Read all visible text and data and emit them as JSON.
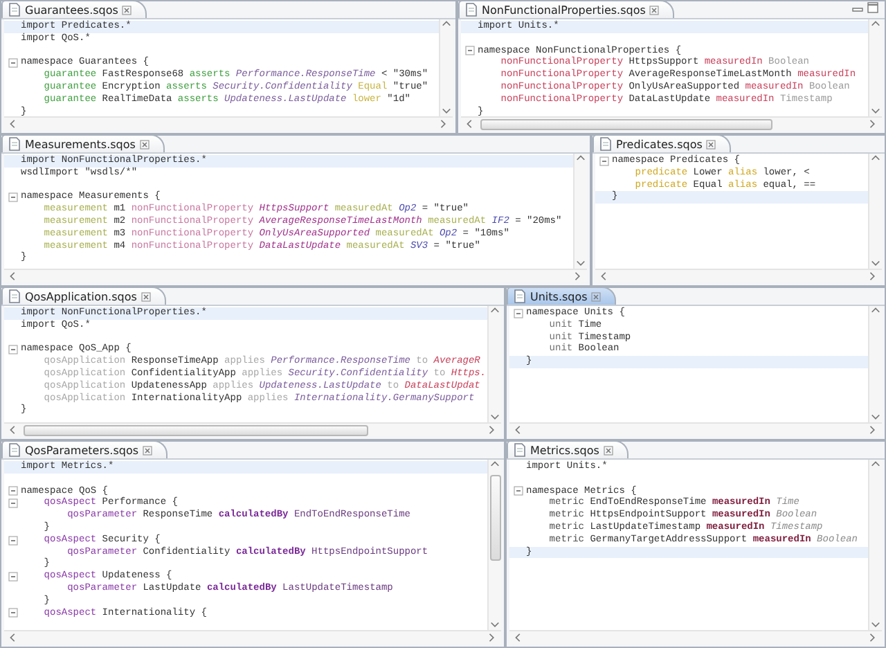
{
  "rows": [
    {
      "panes": [
        {
          "tab": {
            "label": "Guarantees.sqos",
            "selected": false
          },
          "view_buttons": false,
          "lines": [
            {
              "fold": false,
              "highlighted": true,
              "tokens": [
                {
                  "text": "import Predicates.*",
                  "color": "#333333",
                  "kind": "normal"
                }
              ]
            },
            {
              "fold": false,
              "highlighted": false,
              "tokens": [
                {
                  "text": "import QoS.*",
                  "color": "#333333",
                  "kind": "normal"
                }
              ]
            },
            {
              "fold": false,
              "highlighted": false
            },
            {
              "fold": true,
              "highlighted": false,
              "tokens": [
                {
                  "text": "namespace Guarantees {",
                  "color": "#333333",
                  "kind": "normal"
                }
              ]
            },
            {
              "fold": false,
              "highlighted": false,
              "tokens": [
                {
                  "text": "    guarantee",
                  "color": "#3f9f3f",
                  "kind": "normal"
                },
                {
                  "text": " FastResponse68 ",
                  "color": "#333333",
                  "kind": "normal"
                },
                {
                  "text": "asserts",
                  "color": "#3f9f3f",
                  "kind": "normal"
                },
                {
                  "text": " Performance.ResponseTime",
                  "color": "#7a5c9c",
                  "kind": "italic"
                },
                {
                  "text": " < \"30ms\"",
                  "color": "#333333",
                  "kind": "normal"
                }
              ]
            },
            {
              "fold": false,
              "highlighted": false,
              "tokens": [
                {
                  "text": "    guarantee",
                  "color": "#3f9f3f",
                  "kind": "normal"
                },
                {
                  "text": " Encryption ",
                  "color": "#333333",
                  "kind": "normal"
                },
                {
                  "text": "asserts",
                  "color": "#3f9f3f",
                  "kind": "normal"
                },
                {
                  "text": " Security.Confidentiality ",
                  "color": "#7a5c9c",
                  "kind": "italic"
                },
                {
                  "text": "Equal",
                  "color": "#c8b440",
                  "kind": "normal"
                },
                {
                  "text": " \"true\"",
                  "color": "#333333",
                  "kind": "normal"
                }
              ]
            },
            {
              "fold": false,
              "highlighted": false,
              "tokens": [
                {
                  "text": "    guarantee",
                  "color": "#3f9f3f",
                  "kind": "normal"
                },
                {
                  "text": " RealTimeData ",
                  "color": "#333333",
                  "kind": "normal"
                },
                {
                  "text": "asserts",
                  "color": "#3f9f3f",
                  "kind": "normal"
                },
                {
                  "text": " Updateness.LastUpdate ",
                  "color": "#7a5c9c",
                  "kind": "italic"
                },
                {
                  "text": "lower",
                  "color": "#c8b440",
                  "kind": "normal"
                },
                {
                  "text": " \"1d\"",
                  "color": "#333333",
                  "kind": "normal"
                }
              ]
            },
            {
              "fold": false,
              "highlighted": false,
              "tokens": [
                {
                  "text": "}",
                  "color": "#333333",
                  "kind": "normal"
                }
              ]
            }
          ]
        },
        {
          "tab": {
            "label": "NonFunctionalProperties.sqos",
            "selected": false
          },
          "view_buttons": true,
          "lines": [
            {
              "fold": false,
              "highlighted": true,
              "tokens": [
                {
                  "text": "import Units.*",
                  "color": "#333333",
                  "kind": "normal"
                }
              ]
            },
            {
              "fold": false,
              "highlighted": false
            },
            {
              "fold": true,
              "highlighted": false,
              "tokens": [
                {
                  "text": "namespace NonFunctionalProperties {",
                  "color": "#333333",
                  "kind": "normal"
                }
              ]
            },
            {
              "fold": false,
              "highlighted": false,
              "tokens": [
                {
                  "text": "    nonFunctionalProperty",
                  "color": "#c8405a",
                  "kind": "normal"
                },
                {
                  "text": " HttpsSupport ",
                  "color": "#333333",
                  "kind": "normal"
                },
                {
                  "text": "measuredIn",
                  "color": "#c8405a",
                  "kind": "normal"
                },
                {
                  "text": " Boolean",
                  "color": "#9a9a9a",
                  "kind": "normal"
                }
              ]
            },
            {
              "fold": false,
              "highlighted": false,
              "tokens": [
                {
                  "text": "    nonFunctionalProperty",
                  "color": "#c8405a",
                  "kind": "normal"
                },
                {
                  "text": " AverageResponseTimeLastMonth ",
                  "color": "#333333",
                  "kind": "normal"
                },
                {
                  "text": "measuredIn",
                  "color": "#c8405a",
                  "kind": "normal"
                }
              ]
            },
            {
              "fold": false,
              "highlighted": false,
              "tokens": [
                {
                  "text": "    nonFunctionalProperty",
                  "color": "#c8405a",
                  "kind": "normal"
                },
                {
                  "text": " OnlyUsAreaSupported ",
                  "color": "#333333",
                  "kind": "normal"
                },
                {
                  "text": "measuredIn",
                  "color": "#c8405a",
                  "kind": "normal"
                },
                {
                  "text": " Boolean",
                  "color": "#9a9a9a",
                  "kind": "normal"
                }
              ]
            },
            {
              "fold": false,
              "highlighted": false,
              "tokens": [
                {
                  "text": "    nonFunctionalProperty",
                  "color": "#c8405a",
                  "kind": "normal"
                },
                {
                  "text": " DataLastUpdate ",
                  "color": "#333333",
                  "kind": "normal"
                },
                {
                  "text": "measuredIn",
                  "color": "#c8405a",
                  "kind": "normal"
                },
                {
                  "text": " Timestamp",
                  "color": "#9a9a9a",
                  "kind": "normal"
                }
              ]
            },
            {
              "fold": false,
              "highlighted": false,
              "tokens": [
                {
                  "text": "}",
                  "color": "#333333",
                  "kind": "normal"
                }
              ]
            }
          ]
        }
      ]
    },
    {
      "panes": [
        {
          "tab": {
            "label": "Measurements.sqos",
            "selected": false
          },
          "view_buttons": false,
          "lines": [
            {
              "fold": false,
              "highlighted": true,
              "tokens": [
                {
                  "text": "import NonFunctionalProperties.*",
                  "color": "#333333",
                  "kind": "normal"
                }
              ]
            },
            {
              "fold": false,
              "highlighted": false,
              "tokens": [
                {
                  "text": "wsdlImport \"wsdls/*\"",
                  "color": "#333333",
                  "kind": "normal"
                }
              ]
            },
            {
              "fold": false,
              "highlighted": false
            },
            {
              "fold": true,
              "highlighted": false,
              "tokens": [
                {
                  "text": "namespace Measurements {",
                  "color": "#333333",
                  "kind": "normal"
                }
              ]
            },
            {
              "fold": false,
              "highlighted": false,
              "tokens": [
                {
                  "text": "    measurement",
                  "color": "#a8b050",
                  "kind": "normal"
                },
                {
                  "text": " m1 ",
                  "color": "#333333",
                  "kind": "normal"
                },
                {
                  "text": "nonFunctionalProperty",
                  "color": "#c878a0",
                  "kind": "normal"
                },
                {
                  "text": " HttpsSupport ",
                  "color": "#a0308a",
                  "kind": "italic"
                },
                {
                  "text": "measuredAt",
                  "color": "#a8b050",
                  "kind": "normal"
                },
                {
                  "text": " Op2",
                  "color": "#4a4ab0",
                  "kind": "italic"
                },
                {
                  "text": " = \"true\"",
                  "color": "#333333",
                  "kind": "normal"
                }
              ]
            },
            {
              "fold": false,
              "highlighted": false,
              "tokens": [
                {
                  "text": "    measurement",
                  "color": "#a8b050",
                  "kind": "normal"
                },
                {
                  "text": " m2 ",
                  "color": "#333333",
                  "kind": "normal"
                },
                {
                  "text": "nonFunctionalProperty",
                  "color": "#c878a0",
                  "kind": "normal"
                },
                {
                  "text": " AverageResponseTimeLastMonth ",
                  "color": "#a0308a",
                  "kind": "italic"
                },
                {
                  "text": "measuredAt",
                  "color": "#a8b050",
                  "kind": "normal"
                },
                {
                  "text": " IF2",
                  "color": "#4a4ab0",
                  "kind": "italic"
                },
                {
                  "text": " = \"20ms\"",
                  "color": "#333333",
                  "kind": "normal"
                }
              ]
            },
            {
              "fold": false,
              "highlighted": false,
              "tokens": [
                {
                  "text": "    measurement",
                  "color": "#a8b050",
                  "kind": "normal"
                },
                {
                  "text": " m3 ",
                  "color": "#333333",
                  "kind": "normal"
                },
                {
                  "text": "nonFunctionalProperty",
                  "color": "#c878a0",
                  "kind": "normal"
                },
                {
                  "text": " OnlyUsAreaSupported ",
                  "color": "#a0308a",
                  "kind": "italic"
                },
                {
                  "text": "measuredAt",
                  "color": "#a8b050",
                  "kind": "normal"
                },
                {
                  "text": " Op2",
                  "color": "#4a4ab0",
                  "kind": "italic"
                },
                {
                  "text": " = \"10ms\"",
                  "color": "#333333",
                  "kind": "normal"
                }
              ]
            },
            {
              "fold": false,
              "highlighted": false,
              "tokens": [
                {
                  "text": "    measurement",
                  "color": "#a8b050",
                  "kind": "normal"
                },
                {
                  "text": " m4 ",
                  "color": "#333333",
                  "kind": "normal"
                },
                {
                  "text": "nonFunctionalProperty",
                  "color": "#c878a0",
                  "kind": "normal"
                },
                {
                  "text": " DataLastUpdate ",
                  "color": "#a0308a",
                  "kind": "italic"
                },
                {
                  "text": "measuredAt",
                  "color": "#a8b050",
                  "kind": "normal"
                },
                {
                  "text": " SV3",
                  "color": "#4a4ab0",
                  "kind": "italic"
                },
                {
                  "text": " = \"true\"",
                  "color": "#333333",
                  "kind": "normal"
                }
              ]
            },
            {
              "fold": false,
              "highlighted": false,
              "tokens": [
                {
                  "text": "}",
                  "color": "#333333",
                  "kind": "normal"
                }
              ]
            }
          ]
        },
        {
          "tab": {
            "label": "Predicates.sqos",
            "selected": false
          },
          "view_buttons": false,
          "lines": [
            {
              "fold": true,
              "highlighted": false,
              "tokens": [
                {
                  "text": "namespace Predicates {",
                  "color": "#333333",
                  "kind": "normal"
                }
              ]
            },
            {
              "fold": false,
              "highlighted": false,
              "tokens": [
                {
                  "text": "    predicate",
                  "color": "#d0a820",
                  "kind": "normal"
                },
                {
                  "text": " Lower ",
                  "color": "#333333",
                  "kind": "normal"
                },
                {
                  "text": "alias",
                  "color": "#d0a820",
                  "kind": "normal"
                },
                {
                  "text": " lower, <",
                  "color": "#333333",
                  "kind": "normal"
                }
              ]
            },
            {
              "fold": false,
              "highlighted": false,
              "tokens": [
                {
                  "text": "    predicate",
                  "color": "#d0a820",
                  "kind": "normal"
                },
                {
                  "text": " Equal ",
                  "color": "#333333",
                  "kind": "normal"
                },
                {
                  "text": "alias",
                  "color": "#d0a820",
                  "kind": "normal"
                },
                {
                  "text": " equal, ==",
                  "color": "#333333",
                  "kind": "normal"
                }
              ]
            },
            {
              "fold": false,
              "highlighted": true,
              "tokens": [
                {
                  "text": "}",
                  "color": "#333333",
                  "kind": "normal"
                }
              ]
            }
          ]
        }
      ]
    },
    {
      "panes": [
        {
          "tab": {
            "label": "QosApplication.sqos",
            "selected": false
          },
          "view_buttons": false,
          "lines": [
            {
              "fold": false,
              "highlighted": true,
              "tokens": [
                {
                  "text": "import NonFunctionalProperties.*",
                  "color": "#333333",
                  "kind": "normal"
                }
              ]
            },
            {
              "fold": false,
              "highlighted": false,
              "tokens": [
                {
                  "text": "import QoS.*",
                  "color": "#333333",
                  "kind": "normal"
                }
              ]
            },
            {
              "fold": false,
              "highlighted": false
            },
            {
              "fold": true,
              "highlighted": false,
              "tokens": [
                {
                  "text": "namespace QoS_App {",
                  "color": "#333333",
                  "kind": "normal"
                }
              ]
            },
            {
              "fold": false,
              "highlighted": false,
              "tokens": [
                {
                  "text": "    qosApplication",
                  "color": "#a8a8a8",
                  "kind": "normal"
                },
                {
                  "text": " ResponseTimeApp ",
                  "color": "#333333",
                  "kind": "normal"
                },
                {
                  "text": "applies",
                  "color": "#a8a8a8",
                  "kind": "normal"
                },
                {
                  "text": " Performance.ResponseTime ",
                  "color": "#7a5c9c",
                  "kind": "italic"
                },
                {
                  "text": "to",
                  "color": "#a8a8a8",
                  "kind": "normal"
                },
                {
                  "text": " AverageR",
                  "color": "#c8405a",
                  "kind": "italic"
                }
              ]
            },
            {
              "fold": false,
              "highlighted": false,
              "tokens": [
                {
                  "text": "    qosApplication",
                  "color": "#a8a8a8",
                  "kind": "normal"
                },
                {
                  "text": " ConfidentialityApp ",
                  "color": "#333333",
                  "kind": "normal"
                },
                {
                  "text": "applies",
                  "color": "#a8a8a8",
                  "kind": "normal"
                },
                {
                  "text": " Security.Confidentiality ",
                  "color": "#7a5c9c",
                  "kind": "italic"
                },
                {
                  "text": "to",
                  "color": "#a8a8a8",
                  "kind": "normal"
                },
                {
                  "text": " Https.",
                  "color": "#c8405a",
                  "kind": "italic"
                }
              ]
            },
            {
              "fold": false,
              "highlighted": false,
              "tokens": [
                {
                  "text": "    qosApplication",
                  "color": "#a8a8a8",
                  "kind": "normal"
                },
                {
                  "text": " UpdatenessApp ",
                  "color": "#333333",
                  "kind": "normal"
                },
                {
                  "text": "applies",
                  "color": "#a8a8a8",
                  "kind": "normal"
                },
                {
                  "text": " Updateness.LastUpdate ",
                  "color": "#7a5c9c",
                  "kind": "italic"
                },
                {
                  "text": "to",
                  "color": "#a8a8a8",
                  "kind": "normal"
                },
                {
                  "text": " DataLastUpdat",
                  "color": "#c8405a",
                  "kind": "italic"
                }
              ]
            },
            {
              "fold": false,
              "highlighted": false,
              "tokens": [
                {
                  "text": "    qosApplication",
                  "color": "#a8a8a8",
                  "kind": "normal"
                },
                {
                  "text": " InternationalityApp ",
                  "color": "#333333",
                  "kind": "normal"
                },
                {
                  "text": "applies",
                  "color": "#a8a8a8",
                  "kind": "normal"
                },
                {
                  "text": " Internationality.GermanySupport",
                  "color": "#7a5c9c",
                  "kind": "italic"
                }
              ]
            },
            {
              "fold": false,
              "highlighted": false,
              "tokens": [
                {
                  "text": "}",
                  "color": "#333333",
                  "kind": "normal"
                }
              ]
            }
          ]
        },
        {
          "tab": {
            "label": "Units.sqos",
            "selected": true
          },
          "view_buttons": false,
          "lines": [
            {
              "fold": true,
              "highlighted": false,
              "tokens": [
                {
                  "text": "namespace Units {",
                  "color": "#333333",
                  "kind": "normal"
                }
              ]
            },
            {
              "fold": false,
              "highlighted": false,
              "tokens": [
                {
                  "text": "    unit",
                  "color": "#707070",
                  "kind": "normal"
                },
                {
                  "text": " Time",
                  "color": "#333333",
                  "kind": "normal"
                }
              ]
            },
            {
              "fold": false,
              "highlighted": false,
              "tokens": [
                {
                  "text": "    unit",
                  "color": "#707070",
                  "kind": "normal"
                },
                {
                  "text": " Timestamp",
                  "color": "#333333",
                  "kind": "normal"
                }
              ]
            },
            {
              "fold": false,
              "highlighted": false,
              "tokens": [
                {
                  "text": "    unit",
                  "color": "#707070",
                  "kind": "normal"
                },
                {
                  "text": " Boolean",
                  "color": "#333333",
                  "kind": "normal"
                }
              ]
            },
            {
              "fold": false,
              "highlighted": true,
              "tokens": [
                {
                  "text": "}",
                  "color": "#333333",
                  "kind": "normal"
                }
              ]
            }
          ]
        }
      ]
    },
    {
      "panes": [
        {
          "tab": {
            "label": "QosParameters.sqos",
            "selected": false
          },
          "view_buttons": false,
          "lines": [
            {
              "fold": false,
              "highlighted": true,
              "tokens": [
                {
                  "text": "import Metrics.*",
                  "color": "#333333",
                  "kind": "normal"
                }
              ]
            },
            {
              "fold": false,
              "highlighted": false
            },
            {
              "fold": true,
              "highlighted": false,
              "tokens": [
                {
                  "text": "namespace QoS {",
                  "color": "#333333",
                  "kind": "normal"
                }
              ]
            },
            {
              "fold": true,
              "highlighted": false,
              "tokens": [
                {
                  "text": "    qosAspect",
                  "color": "#8a3aa8",
                  "kind": "normal"
                },
                {
                  "text": " Performance {",
                  "color": "#333333",
                  "kind": "normal"
                }
              ]
            },
            {
              "fold": false,
              "highlighted": false,
              "tokens": [
                {
                  "text": "        qosParameter",
                  "color": "#8a3aa8",
                  "kind": "normal"
                },
                {
                  "text": " ResponseTime ",
                  "color": "#333333",
                  "kind": "normal"
                },
                {
                  "text": "calculatedBy",
                  "color": "#7a2a98",
                  "kind": "bold"
                },
                {
                  "text": " EndToEndResponseTime",
                  "color": "#6a3a80",
                  "kind": "normal"
                }
              ]
            },
            {
              "fold": false,
              "highlighted": false,
              "tokens": [
                {
                  "text": "    }",
                  "color": "#333333",
                  "kind": "normal"
                }
              ]
            },
            {
              "fold": true,
              "highlighted": false,
              "tokens": [
                {
                  "text": "    qosAspect",
                  "color": "#8a3aa8",
                  "kind": "normal"
                },
                {
                  "text": " Security {",
                  "color": "#333333",
                  "kind": "normal"
                }
              ]
            },
            {
              "fold": false,
              "highlighted": false,
              "tokens": [
                {
                  "text": "        qosParameter",
                  "color": "#8a3aa8",
                  "kind": "normal"
                },
                {
                  "text": " Confidentiality ",
                  "color": "#333333",
                  "kind": "normal"
                },
                {
                  "text": "calculatedBy",
                  "color": "#7a2a98",
                  "kind": "bold"
                },
                {
                  "text": " HttpsEndpointSupport",
                  "color": "#6a3a80",
                  "kind": "normal"
                }
              ]
            },
            {
              "fold": false,
              "highlighted": false,
              "tokens": [
                {
                  "text": "    }",
                  "color": "#333333",
                  "kind": "normal"
                }
              ]
            },
            {
              "fold": true,
              "highlighted": false,
              "tokens": [
                {
                  "text": "    qosAspect",
                  "color": "#8a3aa8",
                  "kind": "normal"
                },
                {
                  "text": " Updateness {",
                  "color": "#333333",
                  "kind": "normal"
                }
              ]
            },
            {
              "fold": false,
              "highlighted": false,
              "tokens": [
                {
                  "text": "        qosParameter",
                  "color": "#8a3aa8",
                  "kind": "normal"
                },
                {
                  "text": " LastUpdate ",
                  "color": "#333333",
                  "kind": "normal"
                },
                {
                  "text": "calculatedBy",
                  "color": "#7a2a98",
                  "kind": "bold"
                },
                {
                  "text": " LastUpdateTimestamp",
                  "color": "#6a3a80",
                  "kind": "normal"
                }
              ]
            },
            {
              "fold": false,
              "highlighted": false,
              "tokens": [
                {
                  "text": "    }",
                  "color": "#333333",
                  "kind": "normal"
                }
              ]
            },
            {
              "fold": true,
              "highlighted": false,
              "tokens": [
                {
                  "text": "    qosAspect",
                  "color": "#8a3aa8",
                  "kind": "normal"
                },
                {
                  "text": " Internationality {",
                  "color": "#333333",
                  "kind": "normal"
                }
              ]
            }
          ]
        },
        {
          "tab": {
            "label": "Metrics.sqos",
            "selected": false
          },
          "view_buttons": false,
          "lines": [
            {
              "fold": false,
              "highlighted": false,
              "tokens": [
                {
                  "text": "import Units.*",
                  "color": "#333333",
                  "kind": "normal"
                }
              ]
            },
            {
              "fold": false,
              "highlighted": false
            },
            {
              "fold": true,
              "highlighted": false,
              "tokens": [
                {
                  "text": "namespace Metrics {",
                  "color": "#333333",
                  "kind": "normal"
                }
              ]
            },
            {
              "fold": false,
              "highlighted": false,
              "tokens": [
                {
                  "text": "    metric",
                  "color": "#505050",
                  "kind": "normal"
                },
                {
                  "text": " EndToEndResponseTime ",
                  "color": "#333333",
                  "kind": "normal"
                },
                {
                  "text": "measuredIn",
                  "color": "#802040",
                  "kind": "bold"
                },
                {
                  "text": " Time",
                  "color": "#8a8a8a",
                  "kind": "italic"
                }
              ]
            },
            {
              "fold": false,
              "highlighted": false,
              "tokens": [
                {
                  "text": "    metric",
                  "color": "#505050",
                  "kind": "normal"
                },
                {
                  "text": " HttpsEndpointSupport ",
                  "color": "#333333",
                  "kind": "normal"
                },
                {
                  "text": "measuredIn",
                  "color": "#802040",
                  "kind": "bold"
                },
                {
                  "text": " Boolean",
                  "color": "#8a8a8a",
                  "kind": "italic"
                }
              ]
            },
            {
              "fold": false,
              "highlighted": false,
              "tokens": [
                {
                  "text": "    metric",
                  "color": "#505050",
                  "kind": "normal"
                },
                {
                  "text": " LastUpdateTimestamp ",
                  "color": "#333333",
                  "kind": "normal"
                },
                {
                  "text": "measuredIn",
                  "color": "#802040",
                  "kind": "bold"
                },
                {
                  "text": " Timestamp",
                  "color": "#8a8a8a",
                  "kind": "italic"
                }
              ]
            },
            {
              "fold": false,
              "highlighted": false,
              "tokens": [
                {
                  "text": "    metric",
                  "color": "#505050",
                  "kind": "normal"
                },
                {
                  "text": " GermanyTargetAddressSupport ",
                  "color": "#333333",
                  "kind": "normal"
                },
                {
                  "text": "measuredIn",
                  "color": "#802040",
                  "kind": "bold"
                },
                {
                  "text": " Boolean",
                  "color": "#8a8a8a",
                  "kind": "italic"
                }
              ]
            },
            {
              "fold": false,
              "highlighted": true,
              "tokens": [
                {
                  "text": "}",
                  "color": "#333333",
                  "kind": "normal"
                }
              ]
            }
          ]
        }
      ]
    }
  ]
}
